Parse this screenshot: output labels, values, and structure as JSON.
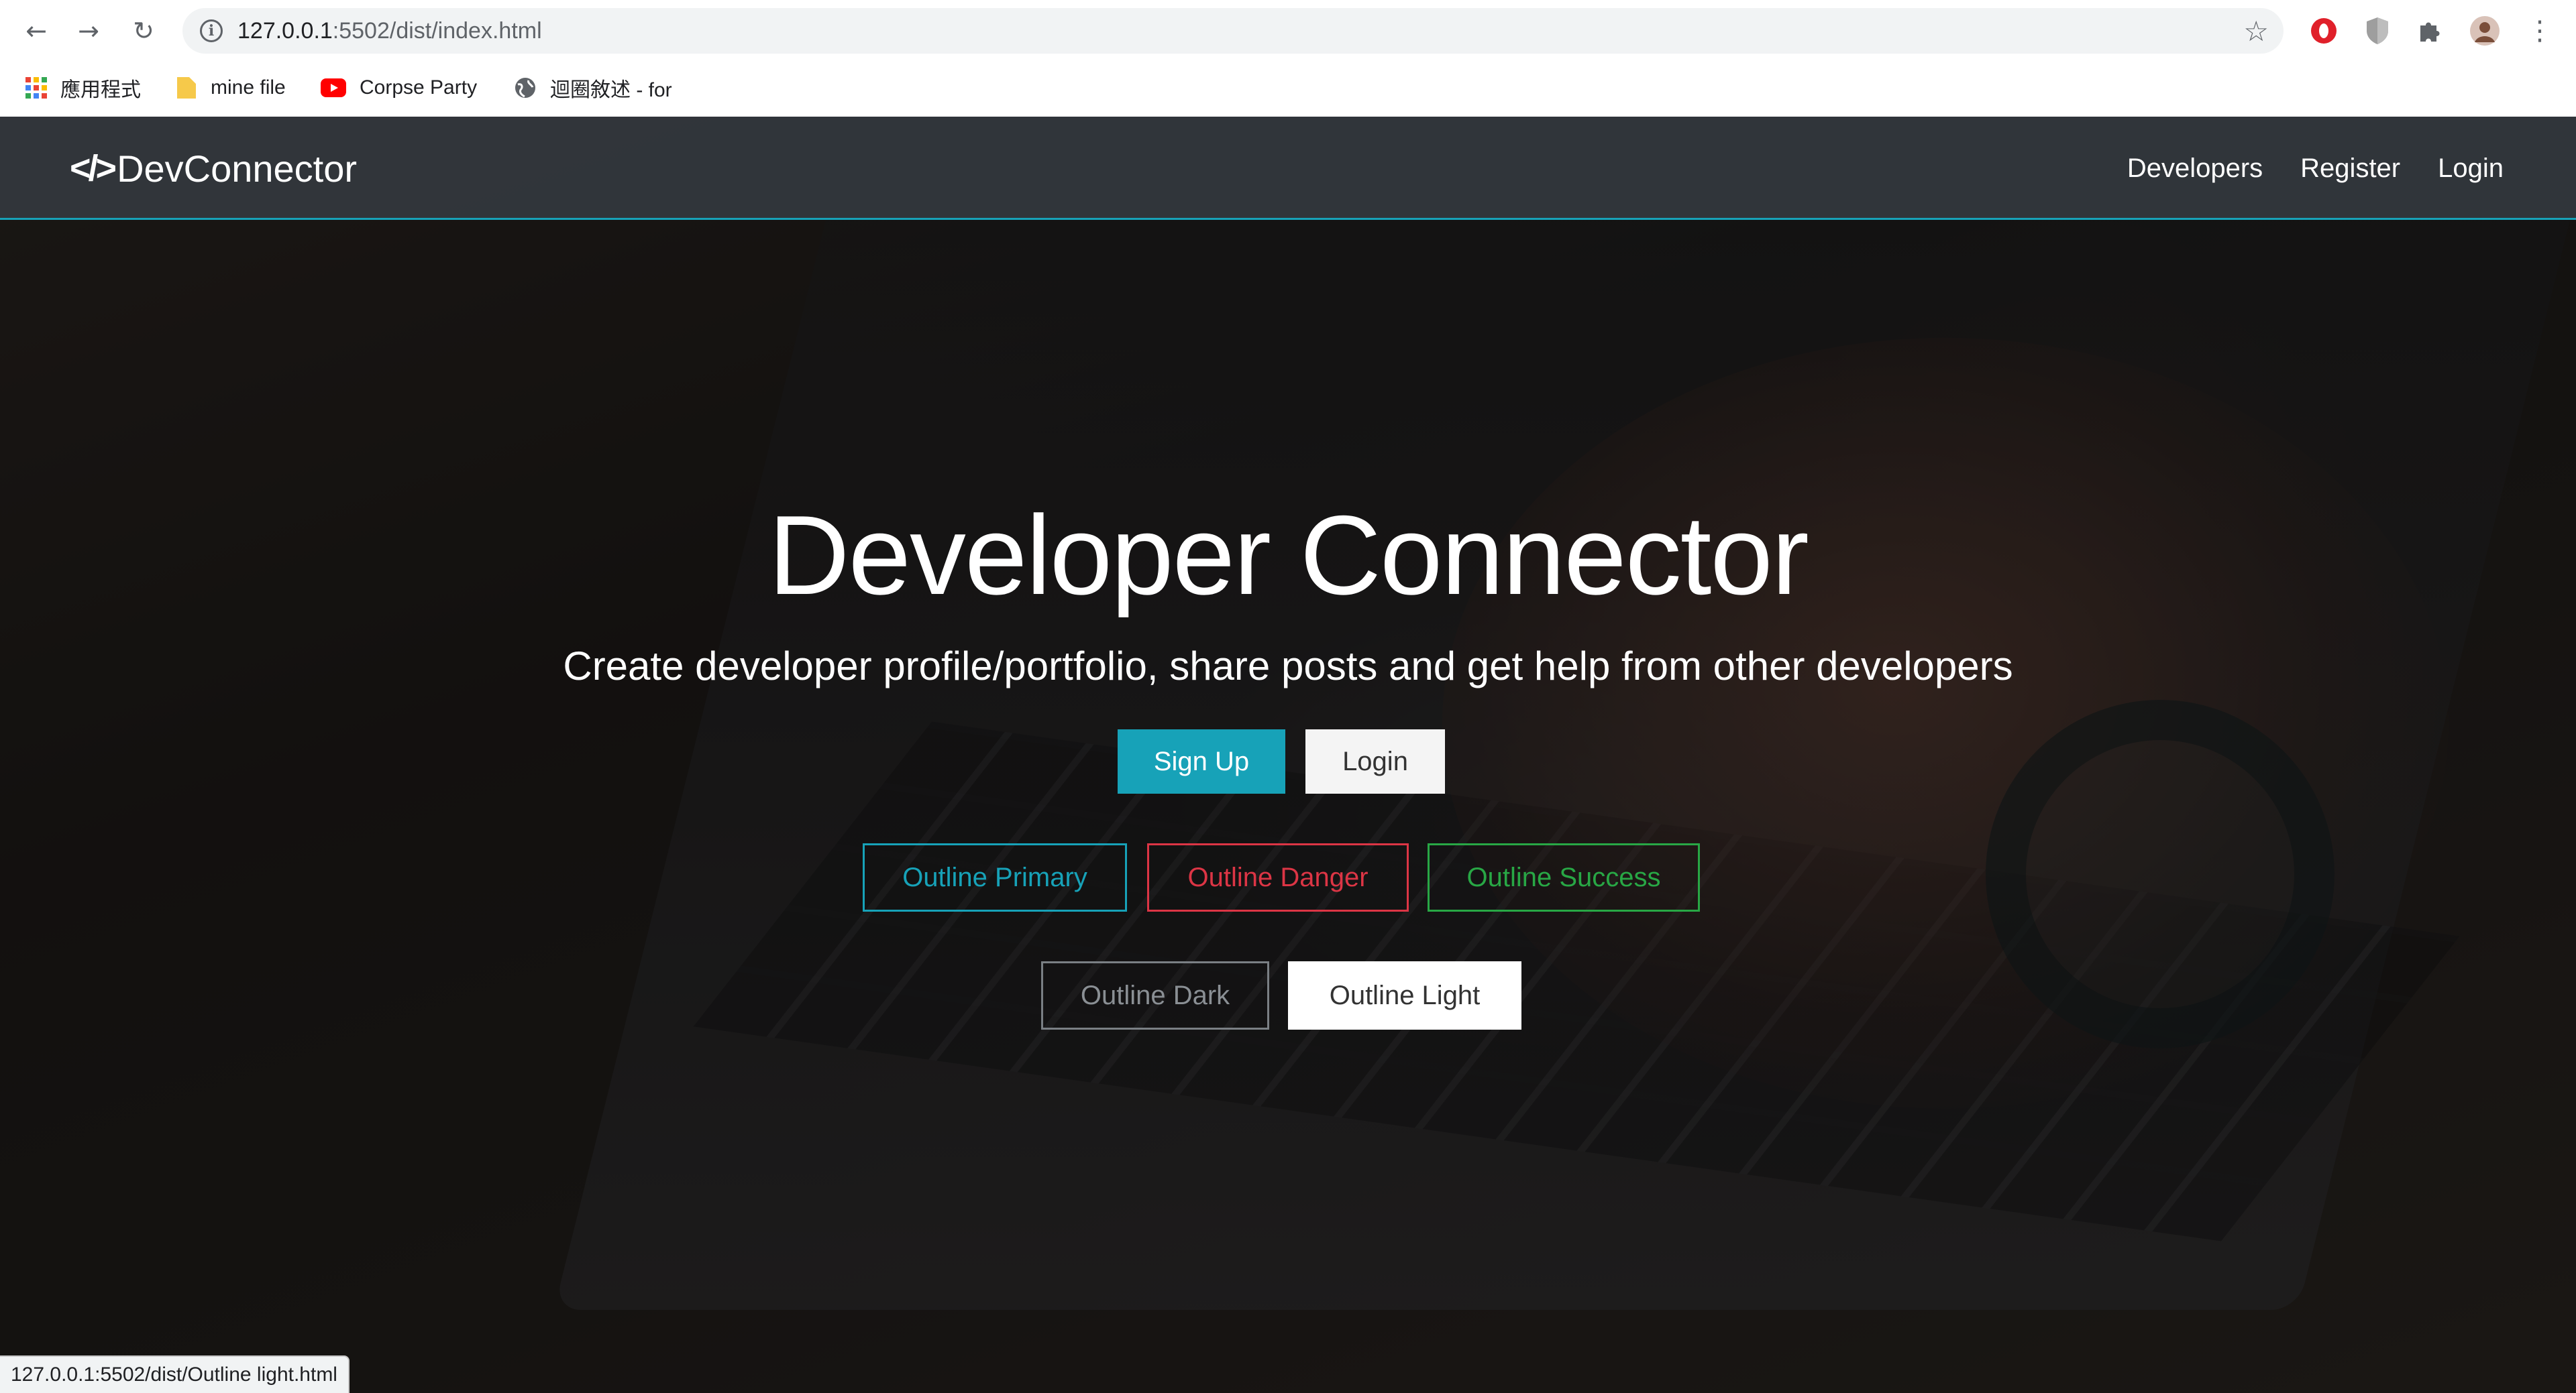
{
  "browser": {
    "url_host": "127.0.0.1",
    "url_path": ":5502/dist/index.html",
    "bookmarks": [
      {
        "label": "應用程式",
        "icon": "apps-grid-icon"
      },
      {
        "label": "mine file",
        "icon": "folder-icon"
      },
      {
        "label": "Corpse Party",
        "icon": "youtube-icon"
      },
      {
        "label": "迴圈敘述 - for",
        "icon": "globe-icon"
      }
    ],
    "status_url": "127.0.0.1:5502/dist/Outline light.html"
  },
  "navbar": {
    "brand": "DevConnector",
    "brand_icon": "</>",
    "links": [
      "Developers",
      "Register",
      "Login"
    ]
  },
  "hero": {
    "title": "Developer Connector",
    "lead": "Create developer profile/portfolio, share posts and get help from other developers",
    "primary_buttons": {
      "signup": "Sign Up",
      "login": "Login"
    },
    "outline_buttons": {
      "primary": "Outline Primary",
      "danger": "Outline Danger",
      "success": "Outline Success",
      "dark": "Outline Dark",
      "light": "Outline Light"
    }
  },
  "colors": {
    "primary": "#17a2b8",
    "danger": "#dc3545",
    "success": "#28a745",
    "dark": "#343a40",
    "light": "#f4f4f4"
  }
}
